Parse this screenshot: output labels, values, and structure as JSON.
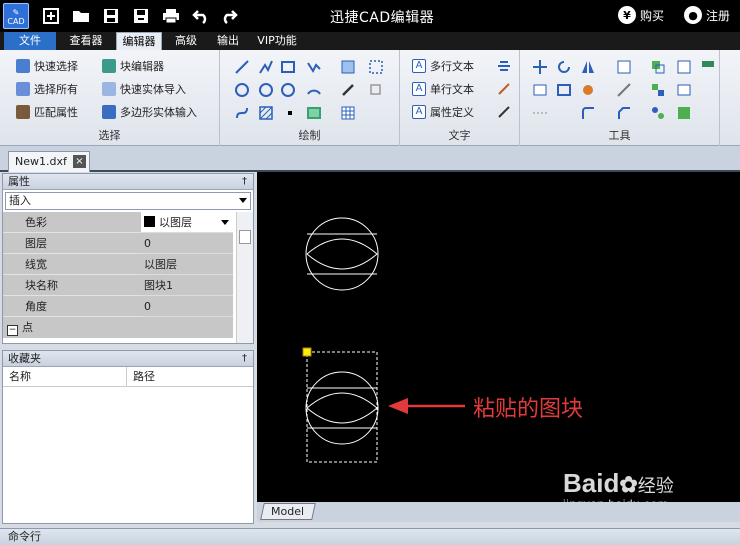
{
  "titlebar": {
    "logo_text": "CAD",
    "title": "迅捷CAD编辑器",
    "buy_label": "购买",
    "buy_icon": "¥",
    "register_label": "注册"
  },
  "menu": {
    "tabs": [
      "文件",
      "查看器",
      "编辑器",
      "高级",
      "输出",
      "VIP功能"
    ],
    "active": "编辑器"
  },
  "ribbon": {
    "select_group": {
      "label": "选择",
      "items": [
        "快速选择",
        "块编辑器",
        "选择所有",
        "快速实体导入",
        "匹配属性",
        "多边形实体输入"
      ]
    },
    "draw_group": {
      "label": "绘制"
    },
    "text_group": {
      "label": "文字",
      "items": [
        "多行文本",
        "单行文本",
        "属性定义"
      ]
    },
    "tools_group": {
      "label": "工具"
    }
  },
  "document": {
    "tab_name": "New1.dxf",
    "close_icon": "×"
  },
  "properties_panel": {
    "title": "属性",
    "pin": "†",
    "selected_type": "插入",
    "rows": [
      {
        "key": "色彩",
        "value": "以图层"
      },
      {
        "key": "图层",
        "value": "0"
      },
      {
        "key": "线宽",
        "value": "以图层"
      },
      {
        "key": "块名称",
        "value": "图块1"
      },
      {
        "key": "角度",
        "value": "0"
      }
    ],
    "section": "点",
    "section_toggle": "−"
  },
  "favorites_panel": {
    "title": "收藏夹",
    "columns": [
      "名称",
      "路径"
    ]
  },
  "canvas": {
    "annotation": "粘贴的图块",
    "model_tab": "Model"
  },
  "command_bar": {
    "label": "命令行"
  },
  "watermark": {
    "brand": "Baid",
    "brand_suffix": "经验",
    "url": "jingyan.baidu.com"
  },
  "colors": {
    "file_tab": "#2b6fc9",
    "canvas_bg": "#000000",
    "arrow": "#e23a3a",
    "grip": "#ffee00"
  }
}
